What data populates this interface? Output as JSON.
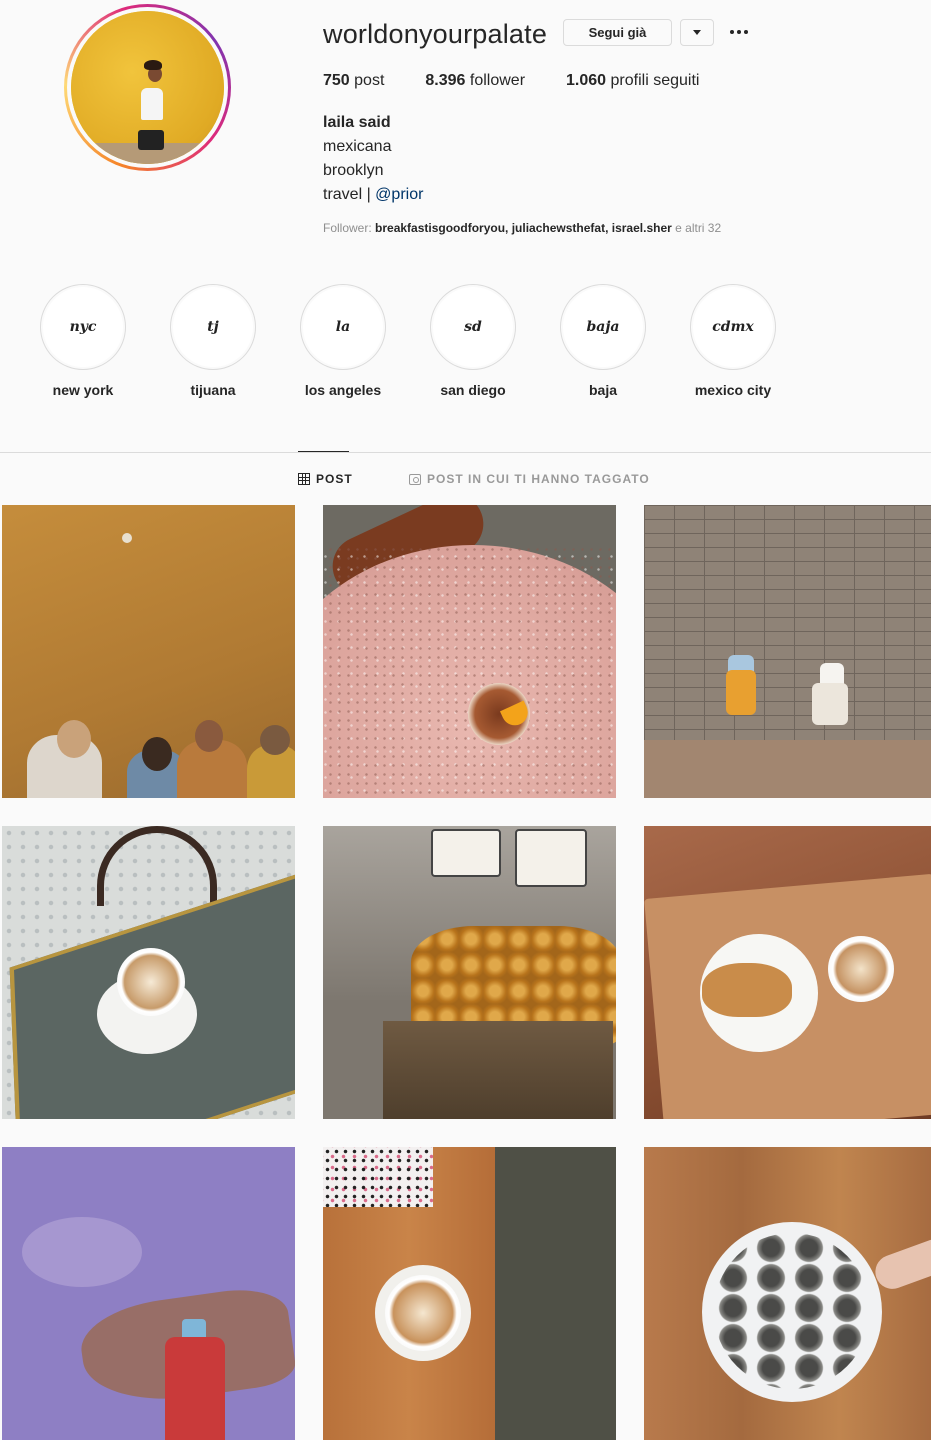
{
  "profile": {
    "username": "worldonyourpalate",
    "follow_button": "Segui già",
    "stats": {
      "posts_count": "750",
      "posts_label": " post",
      "followers_count": "8.396",
      "followers_label": " follower",
      "following_count": "1.060",
      "following_label": " profili seguiti"
    },
    "bio": {
      "name": "laila said",
      "line1": "mexicana",
      "line2": "brooklyn",
      "line3_prefix": "travel | ",
      "line3_mention": "@prior"
    },
    "followed_by": {
      "prefix": "Follower: ",
      "user1": "breakfastisgoodforyou",
      "sep1": ", ",
      "user2": "juliachewsthefat",
      "sep2": ", ",
      "user3": "israel.sher",
      "suffix": " e altri 32"
    }
  },
  "highlights": [
    {
      "cover": "nyc",
      "label": "new york"
    },
    {
      "cover": "tj",
      "label": "tijuana"
    },
    {
      "cover": "la",
      "label": "los angeles"
    },
    {
      "cover": "sd",
      "label": "san diego"
    },
    {
      "cover": "baja",
      "label": "baja"
    },
    {
      "cover": "cdmx",
      "label": "mexico city"
    }
  ],
  "tabs": {
    "posts": "POST",
    "tagged": "POST IN CUI TI HANNO TAGGATO"
  },
  "icons": {
    "more": "more-horizontal-icon",
    "dropdown": "chevron-down-icon",
    "posts_tab": "grid-icon",
    "tagged_tab": "tagged-user-icon"
  }
}
